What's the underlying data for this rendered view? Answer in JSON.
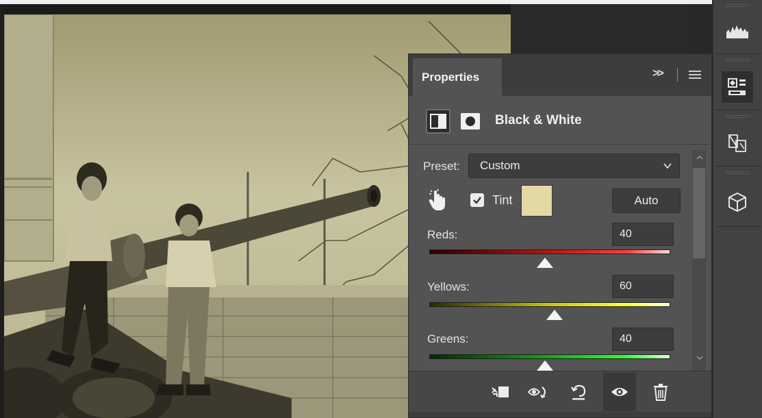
{
  "panel": {
    "tab_title": "Properties",
    "collapse_glyph": "»",
    "adjustment_title": "Black & White"
  },
  "preset": {
    "label": "Preset:",
    "value": "Custom"
  },
  "tint": {
    "label": "Tint",
    "checked": true,
    "color": "#e2d9a5"
  },
  "auto_button": {
    "label": "Auto"
  },
  "sliders": [
    {
      "label": "Reds:",
      "value": "40"
    },
    {
      "label": "Yellows:",
      "value": "60"
    },
    {
      "label": "Greens:",
      "value": "40"
    }
  ],
  "toolbar_icons": [
    "levels-histogram-icon",
    "properties-icon",
    "transform-icon",
    "3d-cube-icon"
  ],
  "bottom_bar_icons": [
    "clip-to-layer-icon",
    "view-previous-state-icon",
    "reset-icon",
    "visibility-eye-icon",
    "trash-icon"
  ],
  "colors": {
    "panel_bg": "#535353",
    "tabbar_bg": "#3d3d3d",
    "tint_swatch": "#e2d9a5"
  }
}
